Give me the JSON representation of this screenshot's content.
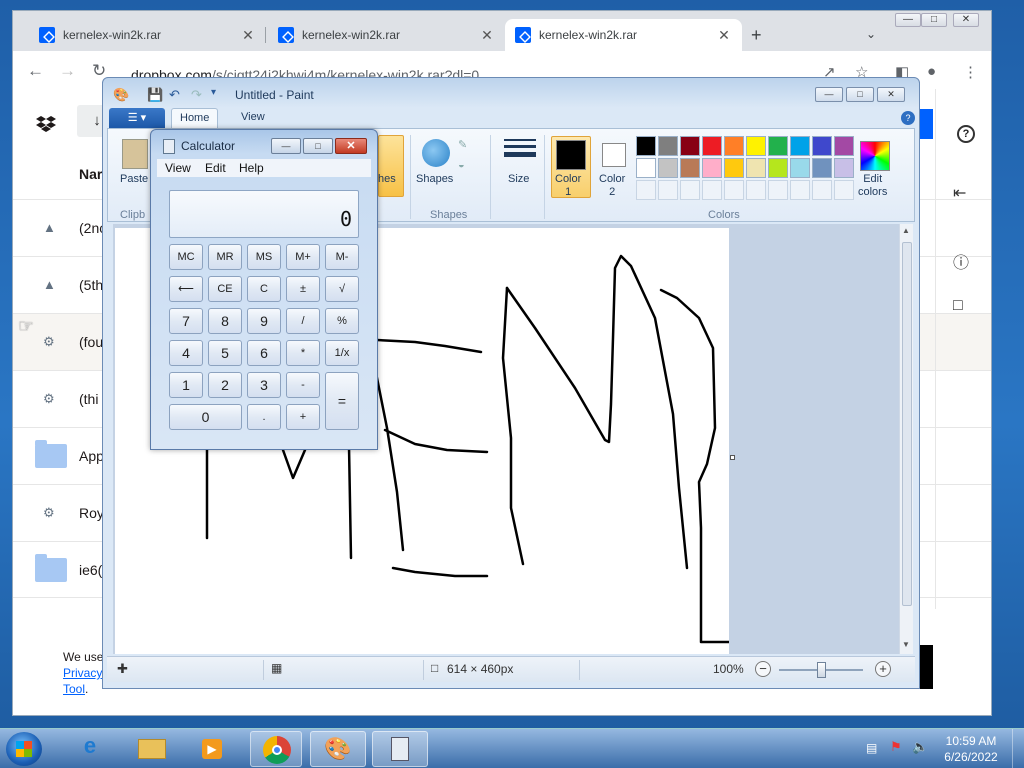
{
  "browser": {
    "tabs": [
      {
        "title": "kernelex-win2k.rar",
        "close": "✕",
        "active": false
      },
      {
        "title": "kernelex-win2k.rar",
        "close": "✕",
        "active": false
      },
      {
        "title": "kernelex-win2k.rar",
        "close": "✕",
        "active": true
      }
    ],
    "new_tab": "+",
    "url_host": "dropbox.com",
    "url_path": "/s/cigtt24i2khwi4m/kernelex-win2k.rar?dl=0"
  },
  "dropbox": {
    "name_header": "Nar",
    "rows": [
      {
        "icon": "drive-icon",
        "name": "(2nc"
      },
      {
        "icon": "drive-icon",
        "name": "(5th"
      },
      {
        "icon": "gear-icon",
        "name": "(fou"
      },
      {
        "icon": "gear-icon",
        "name": "(thi"
      },
      {
        "icon": "folder-icon",
        "name": "App"
      },
      {
        "icon": "gear-icon",
        "name": "Roy"
      },
      {
        "icon": "folder-icon",
        "name": "ie6("
      }
    ],
    "help": "?",
    "cookie_line1": "We use",
    "cookie_link1": "Privacy",
    "cookie_link2": "Tool",
    "cookie_end": "."
  },
  "paint": {
    "title": "Untitled - Paint",
    "tabs": {
      "home": "Home",
      "view": "View"
    },
    "groups": {
      "clipboard": "Clipb",
      "shapes": "Shapes",
      "colors": "Colors"
    },
    "buttons": {
      "paste": "Paste",
      "brushes": "hes",
      "shapes": "Shapes",
      "size": "Size",
      "color1": "Color\n1",
      "color2": "Color\n2",
      "edit_colors": "Edit\ncolors"
    },
    "palette": [
      "#000000",
      "#7f7f7f",
      "#880015",
      "#ed1c24",
      "#ff7f27",
      "#fff200",
      "#22b14c",
      "#00a2e8",
      "#3f48cc",
      "#a349a4",
      "#ffffff",
      "#c3c3c3",
      "#b97a57",
      "#ffaec9",
      "#ffc90e",
      "#efe4b0",
      "#b5e61d",
      "#99d9ea",
      "#7092be",
      "#c8bfe7"
    ],
    "primary_color": "#000000",
    "secondary_color": "#ffffff",
    "status": {
      "dimensions": "614 × 460px",
      "zoom": "100%"
    },
    "drawing_stroke_color": "#000000"
  },
  "calculator": {
    "title": "Calculator",
    "menu": {
      "view": "View",
      "edit": "Edit",
      "help": "Help"
    },
    "display": "0",
    "memory_row": [
      "MC",
      "MR",
      "MS",
      "M+",
      "M-"
    ],
    "row2": [
      "⟵",
      "CE",
      "C",
      "±",
      "√"
    ],
    "row3": [
      "7",
      "8",
      "9",
      "/",
      "%"
    ],
    "row4": [
      "4",
      "5",
      "6",
      "*",
      "1/x"
    ],
    "row5": [
      "1",
      "2",
      "3",
      "-"
    ],
    "row6": [
      ".",
      "+"
    ],
    "zero": "0",
    "equals": "="
  },
  "taskbar": {
    "time": "10:59 AM",
    "date": "6/26/2022",
    "apps": [
      "ie-icon",
      "explorer-icon",
      "media-player-icon",
      "chrome-icon",
      "paint-icon",
      "calculator-icon"
    ]
  }
}
